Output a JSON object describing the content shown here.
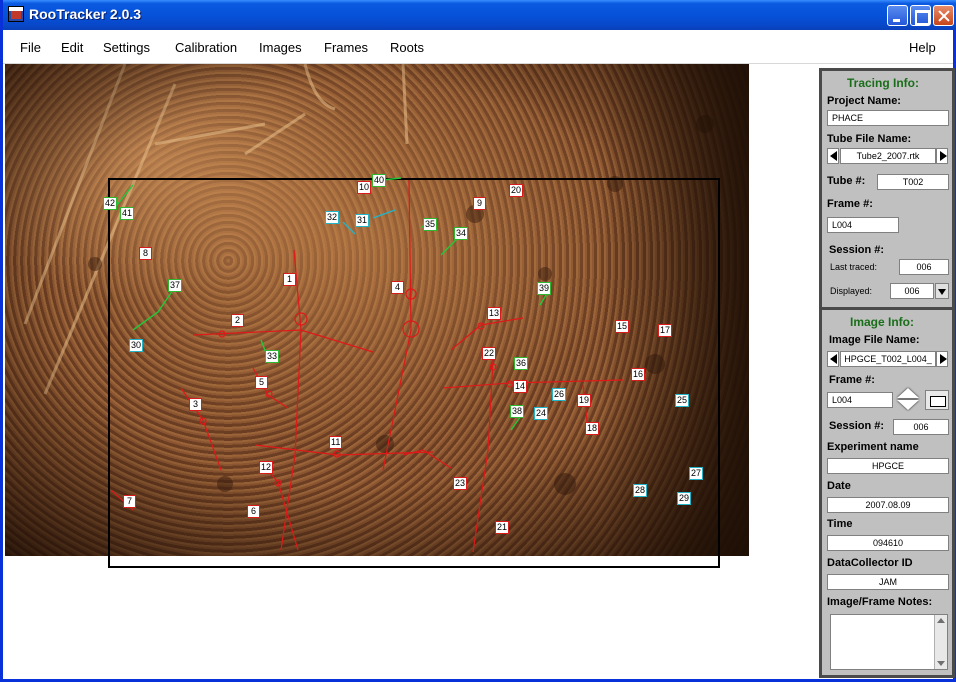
{
  "window": {
    "title": "RooTracker 2.0.3"
  },
  "menu": [
    "File",
    "Edit",
    "Settings",
    "Calibration",
    "Images",
    "Frames",
    "Roots"
  ],
  "help": "Help",
  "tracing": {
    "heading": "Tracing Info:",
    "project_name_label": "Project Name:",
    "project_name": "PHACE",
    "tube_file_label": "Tube File Name:",
    "tube_file": "Tube2_2007.rtk",
    "tube_num_label": "Tube #:",
    "tube_num": "T002",
    "frame_label": "Frame #:",
    "frame": "L004",
    "session_label": "Session #:",
    "last_traced_label": "Last traced:",
    "last_traced": "006",
    "displayed_label": "Displayed:",
    "displayed": "006"
  },
  "image": {
    "heading": "Image Info:",
    "file_label": "Image File Name:",
    "file": "HPGCE_T002_L004_",
    "frame_label": "Frame #:",
    "frame": "L004",
    "session_label": "Session #:",
    "session": "006",
    "experiment_label": "Experiment name",
    "experiment": "HPGCE",
    "date_label": "Date",
    "date": "2007.08.09",
    "time_label": "Time",
    "time": "094610",
    "collector_label": "DataCollector ID",
    "collector": "JAM",
    "notes_label": "Image/Frame Notes:"
  },
  "root_labels": [
    {
      "n": "1",
      "c": "red"
    },
    {
      "n": "2",
      "c": "red"
    },
    {
      "n": "3",
      "c": "red"
    },
    {
      "n": "4",
      "c": "red"
    },
    {
      "n": "5",
      "c": "red"
    },
    {
      "n": "6",
      "c": "red"
    },
    {
      "n": "7",
      "c": "red"
    },
    {
      "n": "8",
      "c": "red"
    },
    {
      "n": "9",
      "c": "red"
    },
    {
      "n": "10",
      "c": "red"
    },
    {
      "n": "11",
      "c": "red"
    },
    {
      "n": "12",
      "c": "red"
    },
    {
      "n": "13",
      "c": "red"
    },
    {
      "n": "14",
      "c": "red"
    },
    {
      "n": "15",
      "c": "red"
    },
    {
      "n": "16",
      "c": "red"
    },
    {
      "n": "17",
      "c": "red"
    },
    {
      "n": "18",
      "c": "red"
    },
    {
      "n": "19",
      "c": "red"
    },
    {
      "n": "20",
      "c": "red"
    },
    {
      "n": "21",
      "c": "red"
    },
    {
      "n": "22",
      "c": "red"
    },
    {
      "n": "23",
      "c": "red"
    },
    {
      "n": "24",
      "c": "cyan"
    },
    {
      "n": "25",
      "c": "cyan"
    },
    {
      "n": "26",
      "c": "cyan"
    },
    {
      "n": "27",
      "c": "cyan"
    },
    {
      "n": "28",
      "c": "cyan"
    },
    {
      "n": "29",
      "c": "cyan"
    },
    {
      "n": "30",
      "c": "cyan"
    },
    {
      "n": "31",
      "c": "cyan"
    },
    {
      "n": "32",
      "c": "cyan"
    },
    {
      "n": "33",
      "c": "green"
    },
    {
      "n": "34",
      "c": "green"
    },
    {
      "n": "35",
      "c": "green"
    },
    {
      "n": "36",
      "c": "green"
    },
    {
      "n": "37",
      "c": "green"
    },
    {
      "n": "38",
      "c": "green"
    },
    {
      "n": "39",
      "c": "green"
    },
    {
      "n": "40",
      "c": "green"
    },
    {
      "n": "41",
      "c": "green"
    },
    {
      "n": "42",
      "c": "green"
    }
  ],
  "colors": {
    "root_active": "#e01818",
    "root_dead": "#22c83a",
    "root_other": "#23b4c8",
    "heading": "#1a6e1a"
  }
}
